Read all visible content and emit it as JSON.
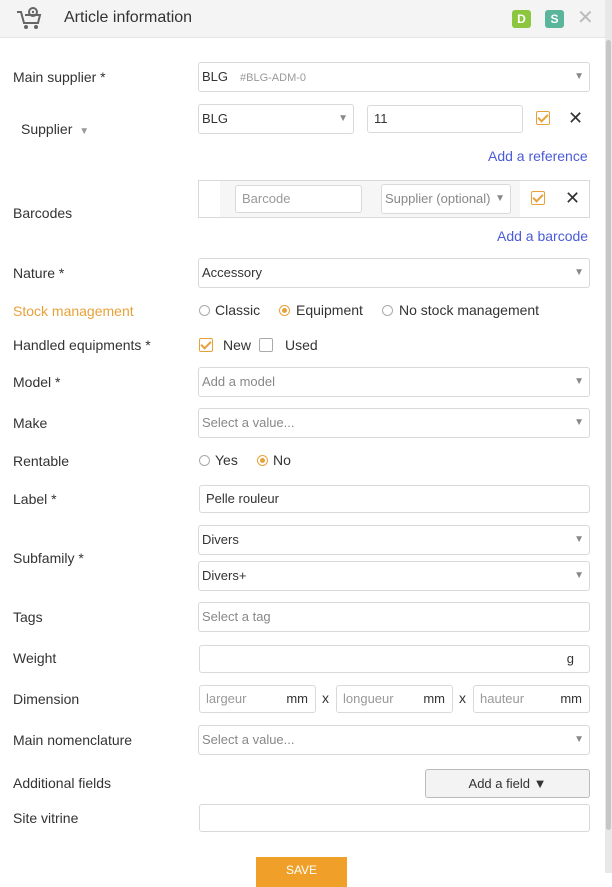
{
  "header": {
    "title": "Article information",
    "badges": [
      "D",
      "S"
    ],
    "icon": "cart-settings-icon",
    "close_icon": "close-icon"
  },
  "colors": {
    "accent": "#e8a13a",
    "link": "#4a5bd8",
    "badge_d": "#8cc63f",
    "badge_s": "#5bb59a",
    "save": "#f0a028"
  },
  "main_supplier": {
    "label": "Main supplier *",
    "value": "BLG",
    "code": "#BLG-ADM-0"
  },
  "supplier": {
    "label": "Supplier",
    "value": "BLG",
    "reference": "11",
    "add_link": "Add a reference"
  },
  "barcodes": {
    "label": "Barcodes",
    "placeholder": "Barcode",
    "supplier_placeholder": "Supplier (optional)",
    "add_link": "Add a barcode"
  },
  "nature": {
    "label": "Nature *",
    "value": "Accessory"
  },
  "stock": {
    "label": "Stock management",
    "options": [
      "Classic",
      "Equipment",
      "No stock management"
    ],
    "selected": "Equipment"
  },
  "handled": {
    "label": "Handled equipments *",
    "options": [
      "New",
      "Used"
    ],
    "checked": [
      "New"
    ]
  },
  "model": {
    "label": "Model *",
    "placeholder": "Add a model"
  },
  "make": {
    "label": "Make",
    "placeholder": "Select a value..."
  },
  "rentable": {
    "label": "Rentable",
    "options": [
      "Yes",
      "No"
    ],
    "selected": "No"
  },
  "label_field": {
    "label": "Label *",
    "value": "Pelle rouleur"
  },
  "subfamily": {
    "label": "Subfamily *",
    "values": [
      "Divers",
      "Divers+"
    ]
  },
  "tags": {
    "label": "Tags",
    "placeholder": "Select a tag"
  },
  "weight": {
    "label": "Weight",
    "unit": "g"
  },
  "dimension": {
    "label": "Dimension",
    "fields": [
      {
        "placeholder": "largeur",
        "unit": "mm"
      },
      {
        "placeholder": "longueur",
        "unit": "mm"
      },
      {
        "placeholder": "hauteur",
        "unit": "mm"
      }
    ],
    "separator": "x"
  },
  "nomenclature": {
    "label": "Main nomenclature",
    "placeholder": "Select a value..."
  },
  "additional": {
    "label": "Additional fields",
    "button": "Add a field ▼"
  },
  "site_vitrine": {
    "label": "Site vitrine"
  },
  "save_label": "SAVE"
}
